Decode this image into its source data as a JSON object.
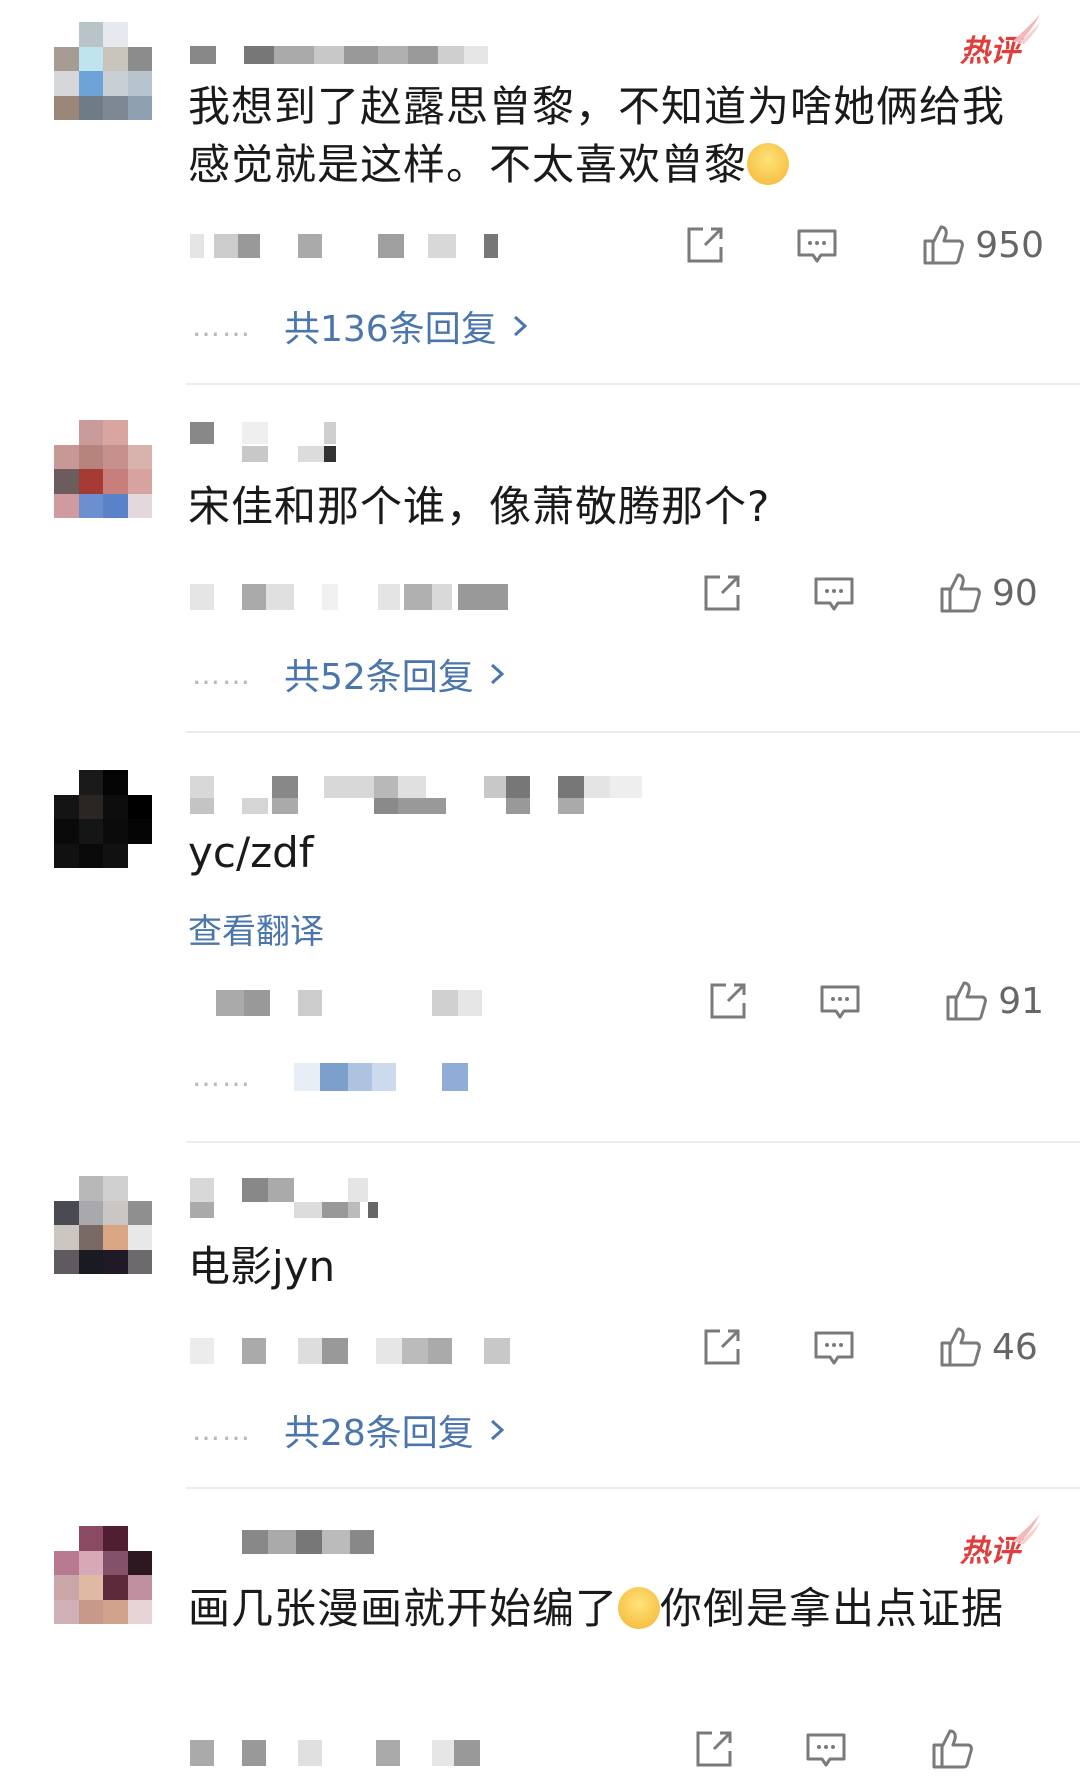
{
  "hot_label": "热评",
  "comments": [
    {
      "text": "我想到了赵露思曾黎，不知道为啥她俩给我感觉就是这样。不太喜欢曾黎",
      "likes": "950",
      "replies": "共136条回复",
      "hot": true
    },
    {
      "text": "宋佳和那个谁，像萧敬腾那个?",
      "likes": "90",
      "replies": "共52条回复",
      "hot": false
    },
    {
      "text": "yc/zdf",
      "translate": "查看翻译",
      "likes": "91",
      "hot": false
    },
    {
      "text": "电影jyn",
      "likes": "46",
      "replies": "共28条回复",
      "hot": false
    },
    {
      "text": "画几张漫画就开始编了你倒是拿出点证据",
      "hot": true
    }
  ],
  "icons": {
    "repost": "share-icon",
    "comment": "comment-icon",
    "like": "thumbs-up-icon",
    "chevron": "chevron-right-icon"
  },
  "colors": {
    "link": "#4a76ad",
    "hot": "#e03d3d",
    "divider": "#ececec"
  }
}
